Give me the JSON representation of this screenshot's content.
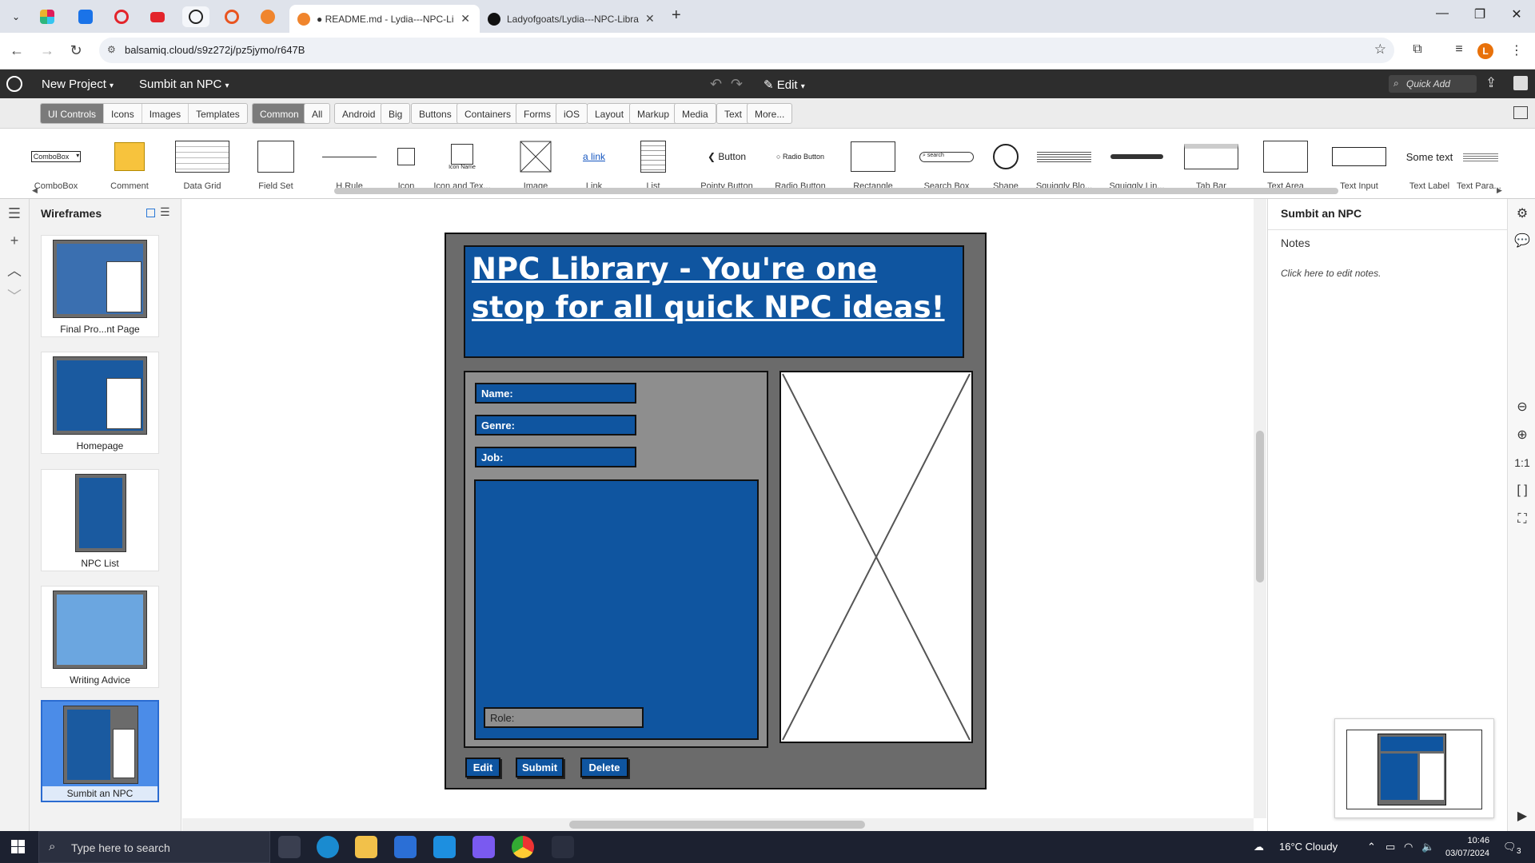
{
  "browser": {
    "tabs": [
      {
        "title": "● README.md - Lydia---NPC-Li",
        "favicon_color": "#f0852d",
        "active": true
      },
      {
        "title": "Ladyofgoats/Lydia---NPC-Libra",
        "favicon_color": "#111111",
        "active": false
      }
    ],
    "url": "balsamiq.cloud/s9z272j/pz5jymo/r647B",
    "profile_initial": "L"
  },
  "app": {
    "project_label": "New Project",
    "page_label": "Sumbit an NPC",
    "mode_label": "Edit",
    "quick_add_placeholder": "Quick Add"
  },
  "library": {
    "primary_tabs": [
      "UI Controls",
      "Icons",
      "Images",
      "Templates"
    ],
    "primary_active": "UI Controls",
    "categories": [
      "Common",
      "All",
      "Android",
      "Big",
      "Buttons",
      "Containers",
      "Forms",
      "iOS",
      "Layout",
      "Markup",
      "Media",
      "Text",
      "More..."
    ],
    "category_active": "Common",
    "components": [
      {
        "label": "ComboBox",
        "preview": "ComboBox"
      },
      {
        "label": "Comment"
      },
      {
        "label": "Data Grid"
      },
      {
        "label": "Field Set"
      },
      {
        "label": "H.Rule"
      },
      {
        "label": "Icon"
      },
      {
        "label": "Icon and Tex...",
        "preview": "Icon Name"
      },
      {
        "label": "Image"
      },
      {
        "label": "Link",
        "preview": "a link"
      },
      {
        "label": "List"
      },
      {
        "label": "Pointy Button",
        "preview": "Button"
      },
      {
        "label": "Radio Button",
        "preview": "Radio Button"
      },
      {
        "label": "Rectangle"
      },
      {
        "label": "Search Box",
        "preview": "search"
      },
      {
        "label": "Shape"
      },
      {
        "label": "Squiggly Blo..."
      },
      {
        "label": "Squiggly Lin..."
      },
      {
        "label": "Tab Bar"
      },
      {
        "label": "Text Area"
      },
      {
        "label": "Text Input"
      },
      {
        "label": "Text Label",
        "preview": "Some text"
      },
      {
        "label": "Text Para..."
      }
    ]
  },
  "wireframes": {
    "header": "Wireframes",
    "pages": [
      {
        "name": "Final Pro...nt Page"
      },
      {
        "name": "Homepage"
      },
      {
        "name": "NPC List"
      },
      {
        "name": "Writing Advice"
      },
      {
        "name": "Sumbit an NPC",
        "selected": true
      }
    ]
  },
  "mockup": {
    "title": "NPC Library - You're one stop for all quick NPC ideas!",
    "fields": {
      "name": "Name:",
      "genre": "Genre:",
      "job": "Job:",
      "role": "Role:"
    },
    "buttons": {
      "edit": "Edit",
      "submit": "Submit",
      "delete": "Delete"
    },
    "colors": {
      "panel": "#6b6b6b",
      "accent_blue": "#0f55a0",
      "form_grey": "#8e8e8e"
    }
  },
  "properties": {
    "title": "Sumbit an NPC",
    "notes_label": "Notes",
    "notes_hint": "Click here to edit notes."
  },
  "right_rail": {
    "zoom_label": "1:1"
  },
  "taskbar": {
    "search_placeholder": "Type here to search",
    "weather": "16°C  Cloudy",
    "time": "10:46",
    "date": "03/07/2024",
    "notifications": "3"
  }
}
